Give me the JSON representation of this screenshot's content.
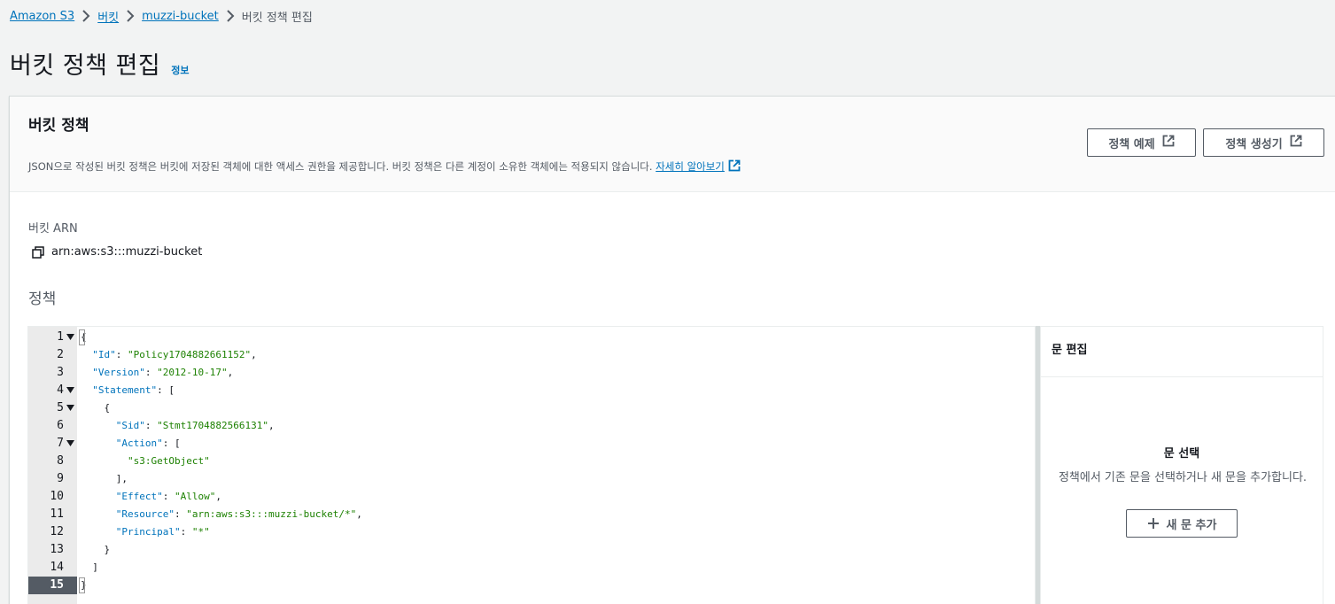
{
  "breadcrumb": {
    "items": [
      "Amazon S3",
      "버킷",
      "muzzi-bucket"
    ],
    "current": "버킷 정책 편집"
  },
  "page": {
    "title": "버킷 정책 편집",
    "info": "정보"
  },
  "section": {
    "title": "버킷 정책",
    "description": "JSON으로 작성된 버킷 정책은 버킷에 저장된 객체에 대한 액세스 권한을 제공합니다. 버킷 정책은 다른 계정이 소유한 객체에는 적용되지 않습니다.",
    "learn_more": "자세히 알아보기",
    "btn_examples": "정책 예제",
    "btn_generator": "정책 생성기"
  },
  "arn": {
    "label": "버킷 ARN",
    "value": "arn:aws:s3:::muzzi-bucket"
  },
  "policy": {
    "label": "정책",
    "active_line": 15,
    "lines": [
      {
        "no": "1",
        "fold": true,
        "code": "{"
      },
      {
        "no": "2",
        "fold": false,
        "code": "  \"Id\": \"Policy1704882661152\","
      },
      {
        "no": "3",
        "fold": false,
        "code": "  \"Version\": \"2012-10-17\","
      },
      {
        "no": "4",
        "fold": true,
        "code": "  \"Statement\": ["
      },
      {
        "no": "5",
        "fold": true,
        "code": "    {"
      },
      {
        "no": "6",
        "fold": false,
        "code": "      \"Sid\": \"Stmt1704882566131\","
      },
      {
        "no": "7",
        "fold": true,
        "code": "      \"Action\": ["
      },
      {
        "no": "8",
        "fold": false,
        "code": "        \"s3:GetObject\""
      },
      {
        "no": "9",
        "fold": false,
        "code": "      ],"
      },
      {
        "no": "10",
        "fold": false,
        "code": "      \"Effect\": \"Allow\","
      },
      {
        "no": "11",
        "fold": false,
        "code": "      \"Resource\": \"arn:aws:s3:::muzzi-bucket/*\","
      },
      {
        "no": "12",
        "fold": false,
        "code": "      \"Principal\": \"*\""
      },
      {
        "no": "13",
        "fold": false,
        "code": "    }"
      },
      {
        "no": "14",
        "fold": false,
        "code": "  ]"
      },
      {
        "no": "15",
        "fold": false,
        "code": "}"
      }
    ]
  },
  "side_panel": {
    "title": "문 편집",
    "empty_title": "문 선택",
    "empty_desc": "정책에서 기존 문을 선택하거나 새 문을 추가합니다.",
    "add_button": "새 문 추가"
  },
  "colors": {
    "link": "#0073bb",
    "string": "#1d8102",
    "background": "#f2f3f3",
    "active_line": "#545b64"
  }
}
